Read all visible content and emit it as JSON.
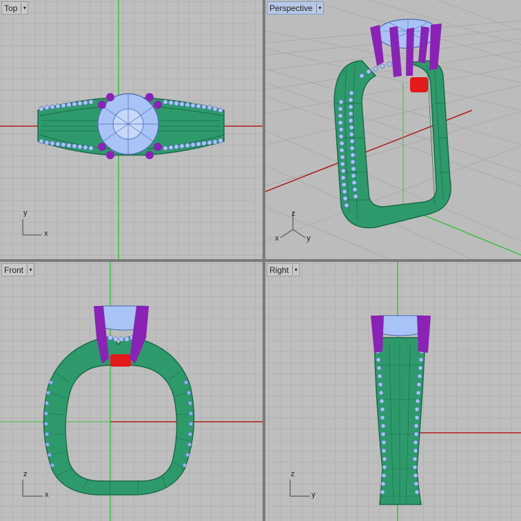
{
  "viewports": {
    "top": {
      "title": "Top",
      "axis_a": "y",
      "axis_b": "x",
      "active": false
    },
    "perspective": {
      "title": "Perspective",
      "axis_z": "z",
      "axis_x": "x",
      "axis_y": "y",
      "active": true
    },
    "front": {
      "title": "Front",
      "axis_a": "z",
      "axis_b": "x",
      "active": false
    },
    "right": {
      "title": "Right",
      "axis_a": "z",
      "axis_b": "y",
      "active": false
    }
  },
  "menu_arrow": "▾",
  "colors": {
    "viewport_bg": "#bebebe",
    "grid_minor": "#a9a9a9",
    "grid_major": "#8e8e8e",
    "axis_x": "#b01818",
    "axis_y": "#3cc03c",
    "ring_band": "#2e9a6c",
    "ring_wire": "#1a6a48",
    "gem": "#a9c3f6",
    "prong": "#8a22b5",
    "seat": "#e21a1a"
  }
}
